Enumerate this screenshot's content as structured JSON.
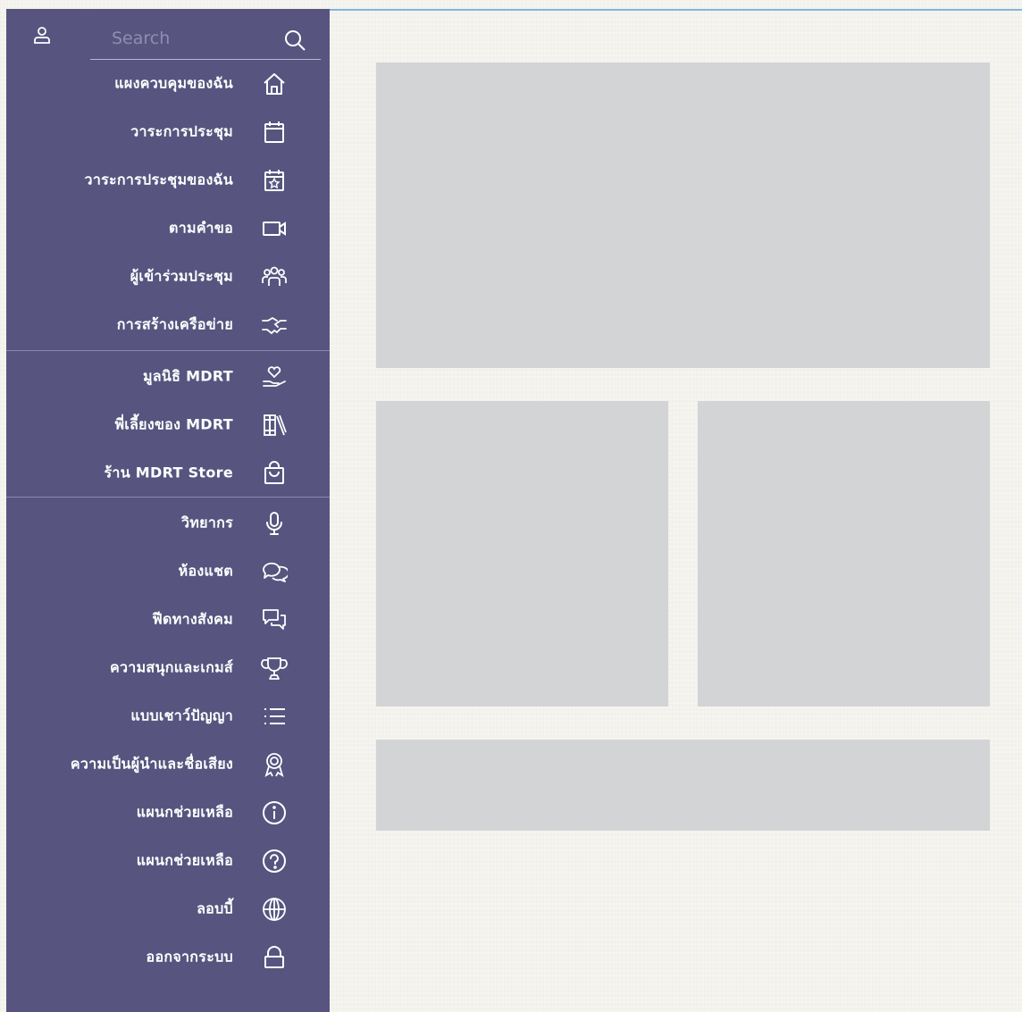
{
  "search": {
    "placeholder": "Search"
  },
  "menu": {
    "items": [
      {
        "label": "แผงควบคุมของฉัน",
        "icon": "home-icon"
      },
      {
        "label": "วาระการประชุม",
        "icon": "calendar-icon"
      },
      {
        "label": "วาระการประชุมของฉัน",
        "icon": "calendar-star-icon"
      },
      {
        "label": "ตามคำขอ",
        "icon": "video-camera-icon"
      },
      {
        "label": "ผู้เข้าร่วมประชุม",
        "icon": "people-group-icon"
      },
      {
        "label": "การสร้างเครือข่าย",
        "icon": "handshake-icon"
      },
      {
        "label": "มูลนิธิ MDRT",
        "icon": "heart-hand-icon"
      },
      {
        "label": "พี่เลี้ยงของ MDRT",
        "icon": "books-icon"
      },
      {
        "label": "ร้าน MDRT Store",
        "icon": "shopping-bag-icon"
      },
      {
        "label": "วิทยากร",
        "icon": "microphone-icon"
      },
      {
        "label": "ห้องแชต",
        "icon": "chat-icon"
      },
      {
        "label": "ฟีดทางสังคม",
        "icon": "chat-bubbles-icon"
      },
      {
        "label": "ความสนุกและเกมส์",
        "icon": "trophy-icon"
      },
      {
        "label": "แบบเชาว์ปัญญา",
        "icon": "list-icon"
      },
      {
        "label": "ความเป็นผู้นำและชื่อเสียง",
        "icon": "award-ribbon-icon"
      },
      {
        "label": "แผนกช่วยเหลือ",
        "icon": "info-icon"
      },
      {
        "label": "แผนกช่วยเหลือ",
        "icon": "question-icon"
      },
      {
        "label": "ลอบบี้",
        "icon": "globe-icon"
      },
      {
        "label": "ออกจากระบบ",
        "icon": "lock-icon"
      }
    ]
  },
  "colors": {
    "sidebar": "#57557f",
    "placeholder": "#d3d4d6",
    "accent_line": "#7fb6dc",
    "background": "#f4f2ec"
  }
}
